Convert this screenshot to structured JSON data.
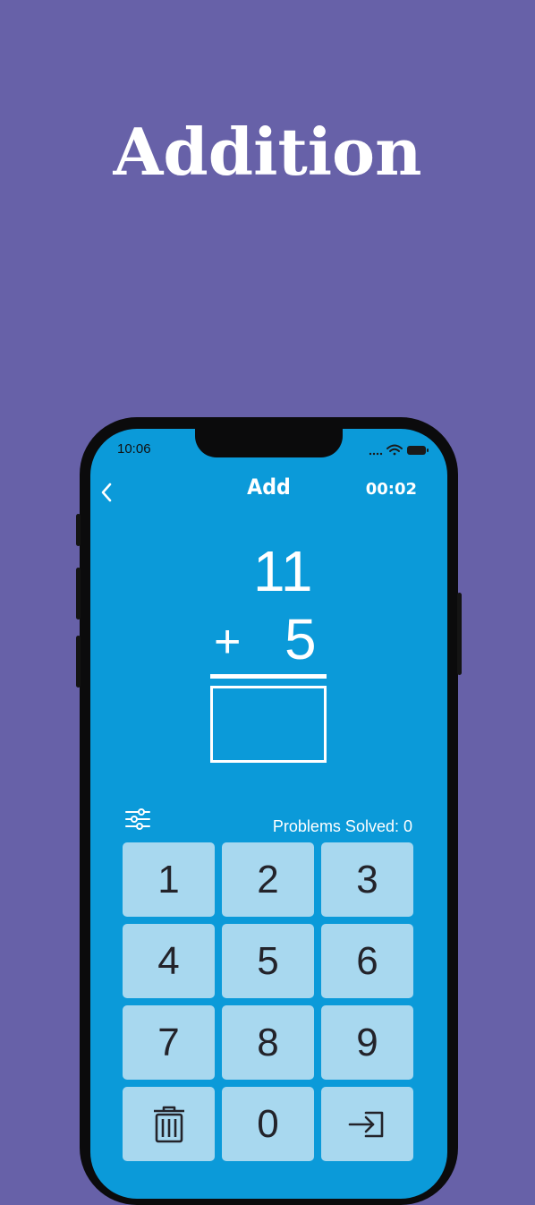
{
  "promo": {
    "title": "Addition"
  },
  "status_bar": {
    "time": "10:06",
    "icons": [
      "signal-icon",
      "wifi-icon",
      "battery-icon"
    ]
  },
  "nav": {
    "back_icon": "chevron-left-icon",
    "title": "Add",
    "timer": "00:02"
  },
  "problem": {
    "operand_top": "11",
    "operator": "+",
    "operand_bottom": "5",
    "answer": ""
  },
  "controls": {
    "settings_icon": "sliders-icon",
    "solved_label": "Problems Solved:",
    "solved_count": "0"
  },
  "keypad": {
    "keys": [
      "1",
      "2",
      "3",
      "4",
      "5",
      "6",
      "7",
      "8",
      "9"
    ],
    "delete_icon": "trash-icon",
    "zero": "0",
    "submit_icon": "enter-icon"
  },
  "colors": {
    "background": "#6761a8",
    "screen": "#0b9ad9",
    "key": "#a8d8ef",
    "key_text": "#23232a",
    "text": "#ffffff"
  }
}
